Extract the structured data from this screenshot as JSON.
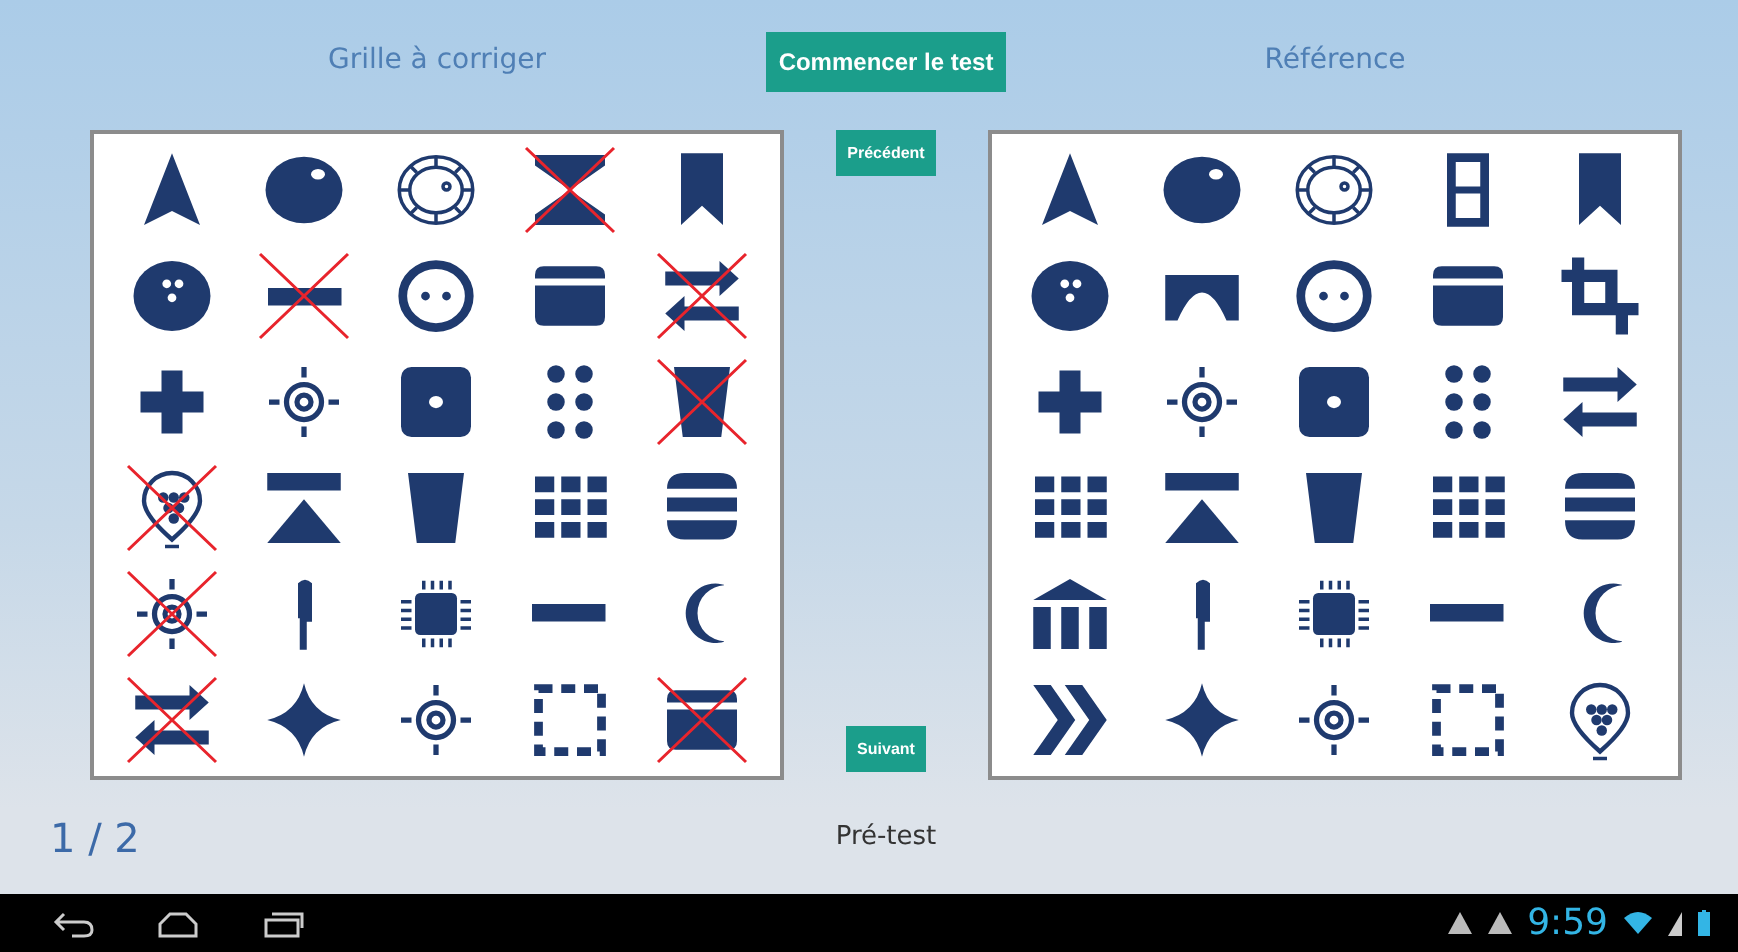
{
  "header": {
    "left_title": "Grille à corriger",
    "start_button": "Commencer le test",
    "right_title": "Référence"
  },
  "grid_to_correct": {
    "cells": [
      {
        "kind": "navigation",
        "crossed": false
      },
      {
        "kind": "ball",
        "crossed": false
      },
      {
        "kind": "wheel",
        "crossed": false
      },
      {
        "kind": "hourglass",
        "crossed": true
      },
      {
        "kind": "bookmark",
        "crossed": false
      },
      {
        "kind": "bowling",
        "crossed": false
      },
      {
        "kind": "bar",
        "crossed": true
      },
      {
        "kind": "button",
        "crossed": false
      },
      {
        "kind": "card",
        "crossed": false
      },
      {
        "kind": "swap",
        "crossed": true
      },
      {
        "kind": "plus",
        "crossed": false
      },
      {
        "kind": "target",
        "crossed": false
      },
      {
        "kind": "dotsquare",
        "crossed": false
      },
      {
        "kind": "dots",
        "crossed": false
      },
      {
        "kind": "cup",
        "crossed": true
      },
      {
        "kind": "pin",
        "crossed": true
      },
      {
        "kind": "eject",
        "crossed": false
      },
      {
        "kind": "cup",
        "crossed": false
      },
      {
        "kind": "grid",
        "crossed": false
      },
      {
        "kind": "stripes",
        "crossed": false
      },
      {
        "kind": "target",
        "crossed": true
      },
      {
        "kind": "knife",
        "crossed": false
      },
      {
        "kind": "chip",
        "crossed": false
      },
      {
        "kind": "bar",
        "crossed": false
      },
      {
        "kind": "moon",
        "crossed": false
      },
      {
        "kind": "swap",
        "crossed": true
      },
      {
        "kind": "star",
        "crossed": false
      },
      {
        "kind": "target",
        "crossed": false
      },
      {
        "kind": "dashed",
        "crossed": false
      },
      {
        "kind": "card",
        "crossed": true
      }
    ]
  },
  "middle": {
    "previous_button": "Précédent",
    "next_button": "Suivant"
  },
  "reference_grid": {
    "cells": [
      {
        "kind": "navigation"
      },
      {
        "kind": "ball"
      },
      {
        "kind": "wheel"
      },
      {
        "kind": "frame"
      },
      {
        "kind": "bookmark"
      },
      {
        "kind": "bowling"
      },
      {
        "kind": "arch"
      },
      {
        "kind": "button"
      },
      {
        "kind": "card"
      },
      {
        "kind": "crop"
      },
      {
        "kind": "plus"
      },
      {
        "kind": "target"
      },
      {
        "kind": "dotsquare"
      },
      {
        "kind": "dots"
      },
      {
        "kind": "swap"
      },
      {
        "kind": "grid"
      },
      {
        "kind": "eject"
      },
      {
        "kind": "cup"
      },
      {
        "kind": "grid"
      },
      {
        "kind": "stripes"
      },
      {
        "kind": "bank"
      },
      {
        "kind": "knife"
      },
      {
        "kind": "chip"
      },
      {
        "kind": "bar"
      },
      {
        "kind": "moon"
      },
      {
        "kind": "chevrons"
      },
      {
        "kind": "star"
      },
      {
        "kind": "target"
      },
      {
        "kind": "dashed"
      },
      {
        "kind": "pin"
      }
    ]
  },
  "footer": {
    "page": "1 / 2",
    "phase": "Pré-test"
  },
  "status_bar": {
    "time": "9:59"
  }
}
